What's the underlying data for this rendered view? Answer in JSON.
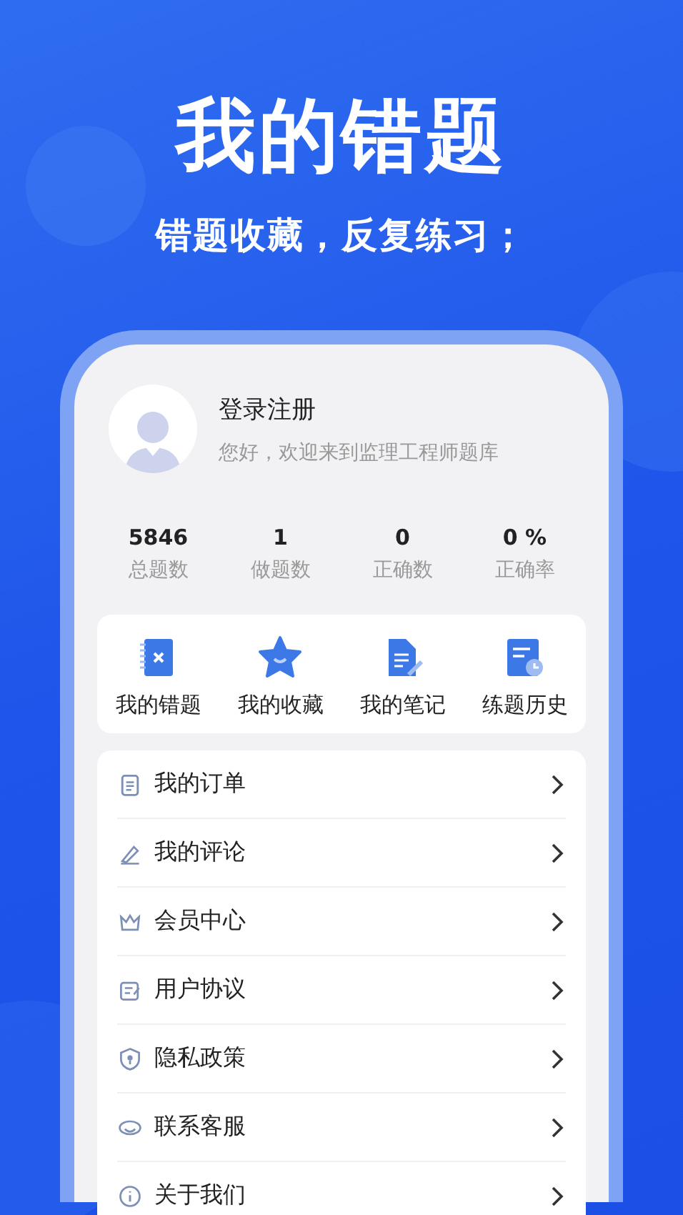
{
  "headline": "我的错题",
  "tagline": "错题收藏，反复练习；",
  "profile": {
    "name": "登录注册",
    "greeting": "您好，欢迎来到监理工程师题库"
  },
  "stats": [
    {
      "value": "5846",
      "label": "总题数"
    },
    {
      "value": "1",
      "label": "做题数"
    },
    {
      "value": "0",
      "label": "正确数"
    },
    {
      "value": "0 %",
      "label": "正确率"
    }
  ],
  "shortcuts": [
    {
      "label": "我的错题"
    },
    {
      "label": "我的收藏"
    },
    {
      "label": "我的笔记"
    },
    {
      "label": "练题历史"
    }
  ],
  "menu": [
    {
      "label": "我的订单"
    },
    {
      "label": "我的评论"
    },
    {
      "label": "会员中心"
    },
    {
      "label": "用户协议"
    },
    {
      "label": "隐私政策"
    },
    {
      "label": "联系客服"
    },
    {
      "label": "关于我们"
    }
  ]
}
